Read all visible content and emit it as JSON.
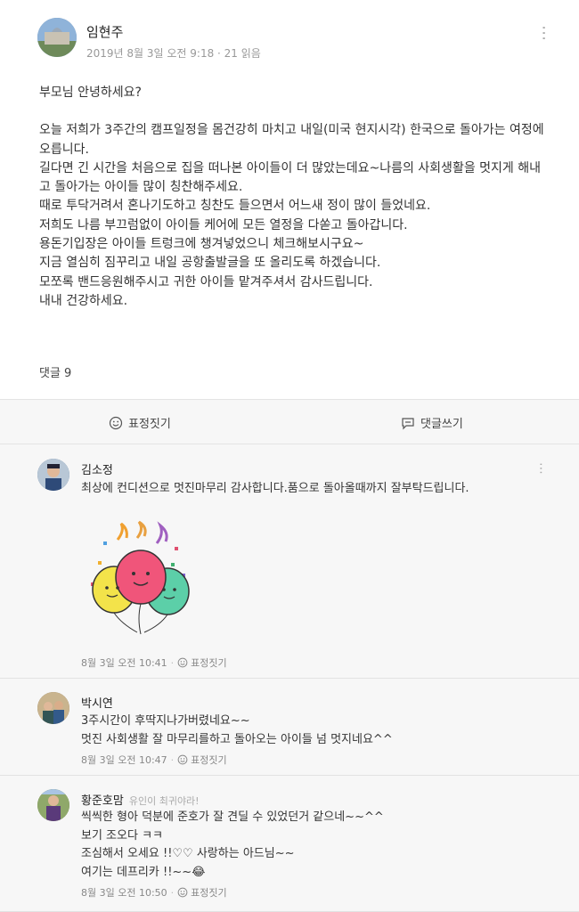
{
  "post": {
    "author": "임현주",
    "meta": "2019년 8월 3일 오전 9:18 · 21 읽음",
    "greeting": "부모님 안녕하세요?",
    "body_lines": [
      "오늘 저희가 3주간의 캠프일정을 몸건강히 마치고 내일(미국 현지시각) 한국으로 돌아가는 여정에 오릅니다.",
      "길다면 긴 시간을 처음으로 집을 떠나본 아이들이 더 많았는데요~나름의 사회생활을 멋지게 해내고 돌아가는 아이들 많이 칭찬해주세요.",
      "때로 투닥거려서 혼나기도하고 칭찬도 들으면서 어느새 정이 많이 들었네요.",
      "저희도 나름 부끄럼없이 아이들 케어에 모든 열정을 다쏟고 돌아갑니다.",
      "용돈기입장은 아이들 트렁크에 챙겨넣었으니 체크해보시구요~",
      "지금 열심히 짐꾸리고 내일 공항출발글을 또 올리도록 하겠습니다.",
      "모쪼록 밴드응원해주시고 귀한 아이들 맡겨주셔서 감사드립니다.",
      "내내 건강하세요."
    ],
    "comment_count_label": "댓글 9"
  },
  "actions": {
    "react_label": "표정짓기",
    "comment_label": "댓글쓰기"
  },
  "comments": [
    {
      "name": "김소정",
      "tag": "",
      "text_lines": [
        "최상에 컨디션으로 멋진마무리 감사합니다.품으로 돌아올때까지 잘부탁드립니다."
      ],
      "time": "8월 3일 오전 10:41",
      "react_label": "표정짓기"
    },
    {
      "name": "박시연",
      "tag": "",
      "text_lines": [
        "3주시간이 후딱지나가버렸네요~~",
        "멋진 사회생활 잘 마무리를하고 돌아오는 아이들 넘 멋지네요^^"
      ],
      "time": "8월 3일 오전 10:47",
      "react_label": "표정짓기"
    },
    {
      "name": "황준호맘",
      "tag": "유인이 최귀야라!",
      "text_lines": [
        "씩씩한 형아 덕분에 준호가 잘 견딜 수 있었던거 같으네~~^^",
        "보기 조오다 ㅋㅋ",
        "조심해서 오세요 !!♡♡ 사랑하는 아드님~~",
        "여기는 데프리카 !!~~😂"
      ],
      "time": "8월 3일 오전 10:50",
      "react_label": "표정짓기"
    }
  ],
  "icons": {
    "more": "more-vertical-icon",
    "smile": "smile-icon",
    "comment": "comment-icon"
  },
  "colors": {
    "background": "#ffffff",
    "comment_area": "#f7f7f7",
    "meta_text": "#999999"
  }
}
